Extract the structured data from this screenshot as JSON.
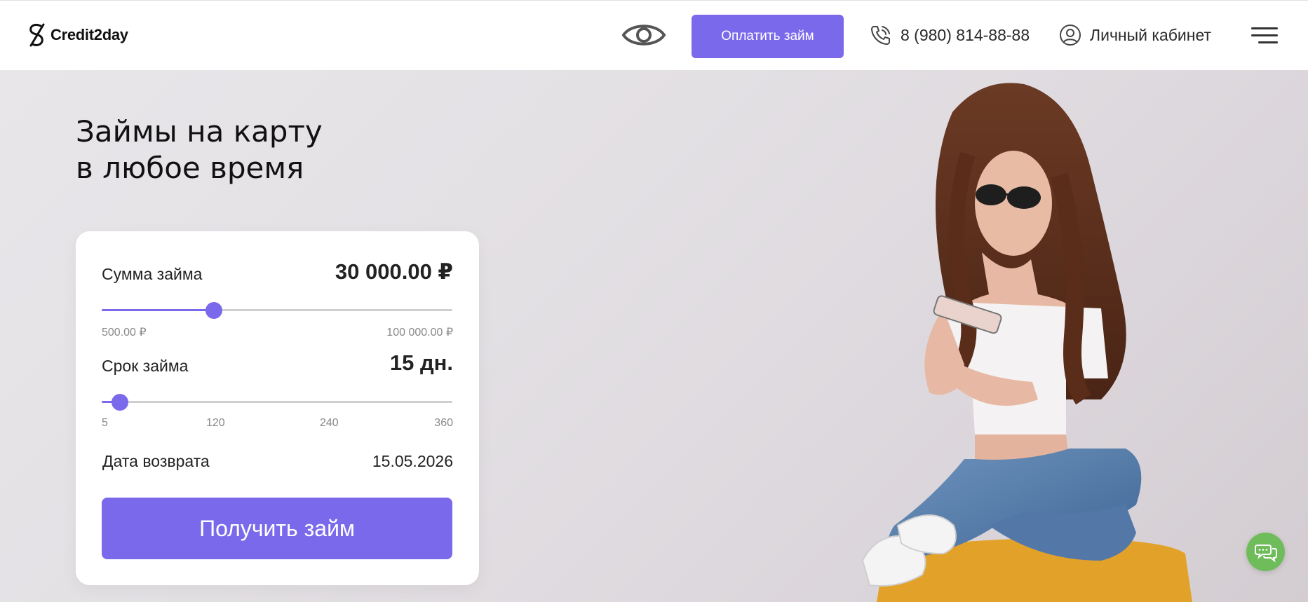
{
  "header": {
    "logo_text": "Credit2day",
    "eye_icon": "eye-icon",
    "pay_button_label": "Оплатить займ",
    "phone_icon": "phone-icon",
    "phone_number": "8 (980) 814-88-88",
    "cabinet_icon": "user-circle-icon",
    "cabinet_label": "Личный кабинет",
    "menu_icon": "hamburger-menu-icon"
  },
  "hero": {
    "title_line1": "Займы на карту",
    "title_line2": "в любое время"
  },
  "calculator": {
    "amount": {
      "label": "Сумма займа",
      "value_text": "30 000.00 ₽",
      "min_label": "500.00 ₽",
      "max_label": "100 000.00 ₽",
      "min": 500,
      "max": 100000,
      "value": 30000
    },
    "term": {
      "label": "Срок займа",
      "value_text": "15 дн.",
      "ticks": [
        "5",
        "120",
        "240",
        "360"
      ],
      "min": 5,
      "max": 360,
      "value": 15
    },
    "return_date": {
      "label": "Дата возврата",
      "value": "15.05.2026"
    },
    "submit_label": "Получить займ"
  },
  "chat": {
    "icon": "chat-bubbles-icon"
  },
  "colors": {
    "accent": "#7b69ec",
    "chat": "#6fbd5a"
  }
}
